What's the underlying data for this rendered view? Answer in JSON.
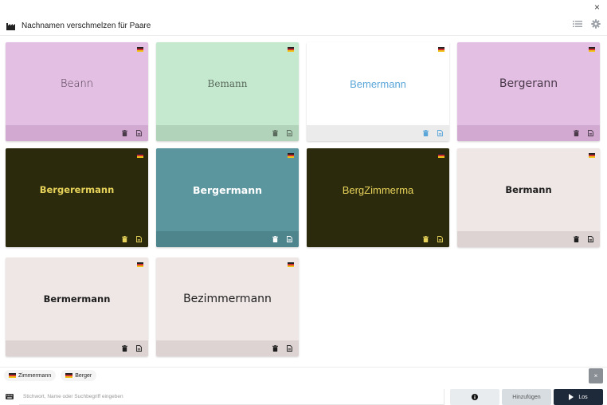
{
  "window": {
    "close_glyph": "×"
  },
  "header": {
    "title": "Nachnamen verschmelzen für Paare",
    "logo_icon": "factory-icon",
    "list_icon": "list-icon",
    "settings_icon": "gear-icon"
  },
  "cards": [
    {
      "name": "Beann",
      "bg": "#e3bfe3",
      "footer": "#d1a9d1",
      "text_color": "#4a3a4a",
      "font": "sans-light",
      "icon_color": "#4a3a4a"
    },
    {
      "name": "Bemann",
      "bg": "#c5e9cf",
      "footer": "#b1d3b9",
      "text_color": "#5a6a5d",
      "font": "serif",
      "icon_color": "#5a6a5d"
    },
    {
      "name": "Bemermann",
      "bg": "#ffffff",
      "footer": "#ebebeb",
      "text_color": "#5aa6d8",
      "font": "sans",
      "icon_color": "#5aa6d8"
    },
    {
      "name": "Bergerann",
      "bg": "#e3bfe3",
      "footer": "#d1a9d1",
      "text_color": "#4a3a4a",
      "font": "sans-large",
      "icon_color": "#4a3a4a"
    },
    {
      "name": "Bergerermann",
      "bg": "#2c2a0d",
      "footer": "#2c2a0d",
      "text_color": "#e7d35a",
      "font": "sans-bold",
      "icon_color": "#e7d35a"
    },
    {
      "name": "Bergermann",
      "bg": "#5b959e",
      "footer": "#4e848c",
      "text_color": "#ffffff",
      "font": "sans-heavy",
      "icon_color": "#ffffff"
    },
    {
      "name": "BergZimmerma",
      "bg": "#2c2a0d",
      "footer": "#2c2a0d",
      "text_color": "#e7d35a",
      "font": "sans",
      "icon_color": "#e7d35a"
    },
    {
      "name": "Bermann",
      "bg": "#efe7e6",
      "footer": "#dcd3d2",
      "text_color": "#1e1e1e",
      "font": "sans-bold",
      "icon_color": "#1e1e1e"
    },
    {
      "name": "Bermermann",
      "bg": "#efe7e6",
      "footer": "#dcd3d2",
      "text_color": "#1e1e1e",
      "font": "sans-bold",
      "icon_color": "#1e1e1e"
    },
    {
      "name": "Bezimmermann",
      "bg": "#efe7e6",
      "footer": "#dcd3d2",
      "text_color": "#1e1e1e",
      "font": "sans-large",
      "icon_color": "#1e1e1e"
    }
  ],
  "chips": [
    {
      "label": "Zimmermann"
    },
    {
      "label": "Berger"
    }
  ],
  "clear_glyph": "×",
  "input": {
    "placeholder": "Stichwort, Name oder Suchbegriff eingeben",
    "value": ""
  },
  "buttons": {
    "info_icon": "info-icon",
    "add_label": "Hinzufügen",
    "go_label": "Los"
  }
}
